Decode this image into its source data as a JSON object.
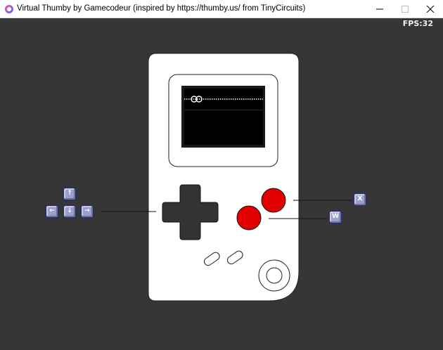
{
  "window": {
    "title": "Virtual Thumby by Gamecodeur (inspired by https://thumby.us/ from TinyCircuits)",
    "minimize_icon": "minimize-icon",
    "maximize_icon": "maximize-icon",
    "close_icon": "close-icon"
  },
  "hud": {
    "fps_label": "FPS:32"
  },
  "keys": {
    "up": "↑",
    "left": "←",
    "down": "↓",
    "right": "→",
    "x": "X",
    "w": "W"
  },
  "colors": {
    "background": "#363636",
    "device_body": "#ffffff",
    "screen": "#000000",
    "dpad": "#333333",
    "ab_buttons": "#e00000",
    "key_cap": "#9aa0c8"
  }
}
